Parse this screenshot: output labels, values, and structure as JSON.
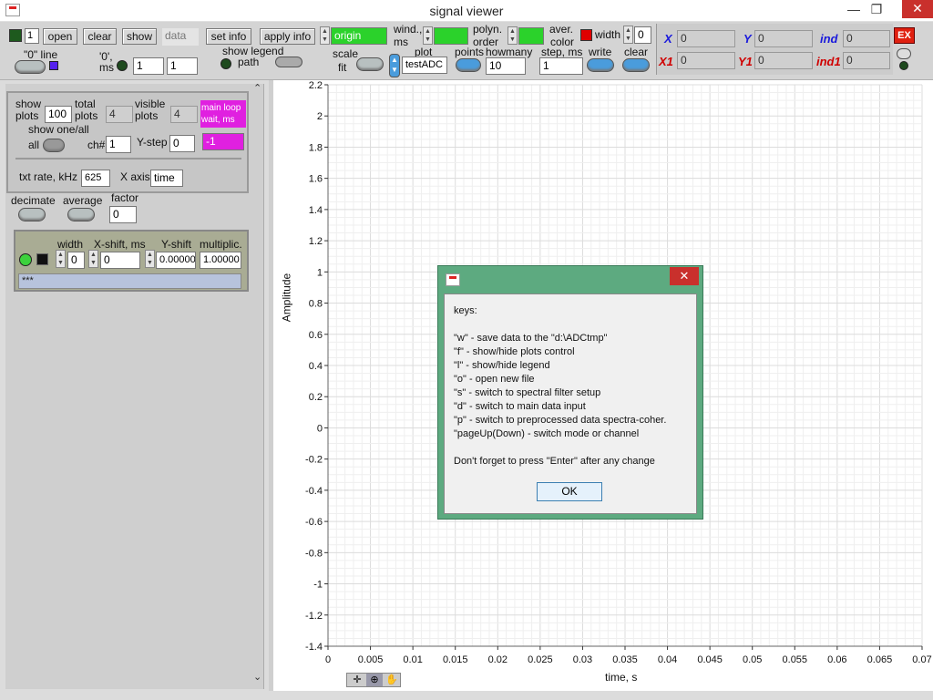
{
  "window": {
    "title": "signal viewer",
    "minimize": "—",
    "maximize": "❐",
    "close": "✕"
  },
  "toolbar": {
    "file_index": "1",
    "open": "open",
    "clear": "clear",
    "show": "show",
    "data": "data",
    "set_info": "set info",
    "apply_info": "apply info",
    "origin": "origin",
    "zero_line": "\"0\" line",
    "zero_ms": "'0',\nms",
    "ms1": "1",
    "ms2": "1",
    "show_legend": "show legend",
    "path": "path",
    "scale": "scale",
    "fit": "fit",
    "wind": "wind.,",
    "ms": "ms",
    "plot": "plot",
    "plot_value": "testADC",
    "points": "points",
    "howmany": "howmany",
    "howmany_value": "10",
    "polyn": "polyn.",
    "order": "order",
    "step": "step, ms",
    "step_value": "1",
    "aver": "aver.",
    "color": "color",
    "width": "width",
    "width_value": "0",
    "write": "write",
    "clear2": "clear",
    "X": "X",
    "Y": "Y",
    "ind": "ind",
    "X1": "X1",
    "Y1": "Y1",
    "ind1": "ind1",
    "x_val": "0",
    "y_val": "0",
    "ind_val": "0",
    "x1_val": "0",
    "y1_val": "0",
    "ind1_val": "0",
    "ex": "EX"
  },
  "panel": {
    "show_plots": "show\nplots",
    "show_plots_val": "100",
    "total_plots": "total\nplots",
    "total_plots_val": "4",
    "visible_plots": "visible\nplots",
    "visible_plots_val": "4",
    "main_loop": "main loop\nwait, ms",
    "main_loop_val": "-1",
    "show_one_all": "show one/all",
    "all": "all",
    "ch": "ch#",
    "ch_val": "1",
    "ystep": "Y-step",
    "ystep_val": "0",
    "txt_rate": "txt rate, kHz",
    "txt_rate_val": "625",
    "x_axis": "X axis",
    "x_axis_val": "time",
    "decimate": "decimate",
    "average": "average",
    "factor": "factor",
    "factor_val": "0",
    "width": "width",
    "xshift": "X-shift, ms",
    "yshift": "Y-shift",
    "multiplic": "multiplic.",
    "width_val": "0",
    "xshift_val": "0",
    "yshift_val": "0.00000",
    "multiplic_val": "1.00000",
    "legend_text": "***"
  },
  "chart_data": {
    "type": "line",
    "xlabel": "time, s",
    "ylabel": "Amplitude",
    "xlim": [
      0,
      0.07
    ],
    "ylim": [
      -1.4,
      2.2
    ],
    "xticks": [
      "0",
      "0.005",
      "0.01",
      "0.015",
      "0.02",
      "0.025",
      "0.03",
      "0.035",
      "0.04",
      "0.045",
      "0.05",
      "0.055",
      "0.06",
      "0.065",
      "0.07"
    ],
    "yticks": [
      "2.2",
      "2",
      "1.8",
      "1.6",
      "1.4",
      "1.2",
      "1",
      "0.8",
      "0.6",
      "0.4",
      "0.2",
      "0",
      "-0.2",
      "-0.4",
      "-0.6",
      "-0.8",
      "-1",
      "-1.2",
      "-1.4"
    ],
    "grid": true,
    "series": []
  },
  "dialog": {
    "keys": "keys:",
    "lines": [
      "\"w\" - save data to the \"d:\\ADCtmp\"",
      "\"f\" - show/hide plots control",
      "\"l\" - show/hide legend",
      "\"o\" - open new file",
      "\"s\" - switch to spectral filter setup",
      "\"d\" - switch to main data input",
      "\"p\" - switch to preprocessed data spectra-coher.",
      "\"pageUp(Down) -  switch mode or channel"
    ],
    "note": "Don't forget to press \"Enter\" after any change",
    "ok": "OK",
    "close": "✕"
  },
  "colors": {
    "green": "#2bd22b",
    "magenta": "#e020e0",
    "red": "#d00000",
    "blue": "#1a1adc",
    "dialog": "#5daa80"
  }
}
